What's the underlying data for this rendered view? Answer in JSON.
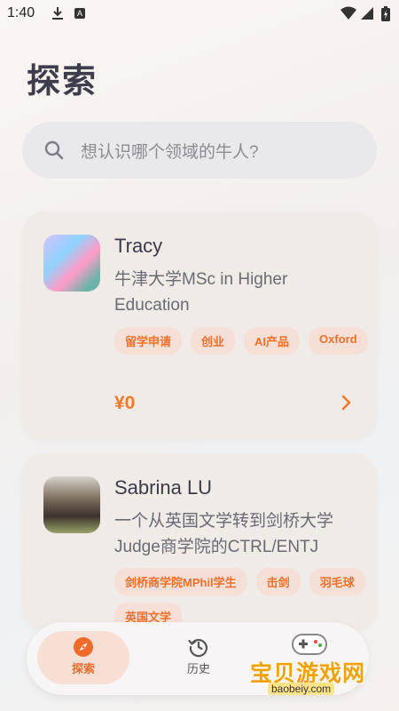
{
  "status_bar": {
    "time": "1:40"
  },
  "page": {
    "title": "探索"
  },
  "search": {
    "placeholder": "想认识哪个领域的牛人?"
  },
  "cards": [
    {
      "name": "Tracy",
      "headline": "牛津大学MSc in Higher Education",
      "tags": [
        "留学申请",
        "创业",
        "AI产品",
        "Oxford"
      ],
      "price": "¥0"
    },
    {
      "name": "Sabrina LU",
      "headline": "一个从英国文学转到剑桥大学Judge商学院的CTRL/ENTJ",
      "tags": [
        "剑桥商学院MPhil学生",
        "击剑",
        "羽毛球",
        "英国文学"
      ]
    }
  ],
  "bottom_nav": {
    "items": [
      {
        "label": "探索",
        "icon": "compass-icon",
        "active": true
      },
      {
        "label": "历史",
        "icon": "history-icon",
        "active": false
      }
    ]
  },
  "watermark": {
    "text": "宝贝游戏网",
    "url": "baobeiy.com"
  },
  "colors": {
    "accent": "#f07a2c",
    "tag_bg": "#f6dfd7",
    "card_bg": "#f1ebe8"
  }
}
